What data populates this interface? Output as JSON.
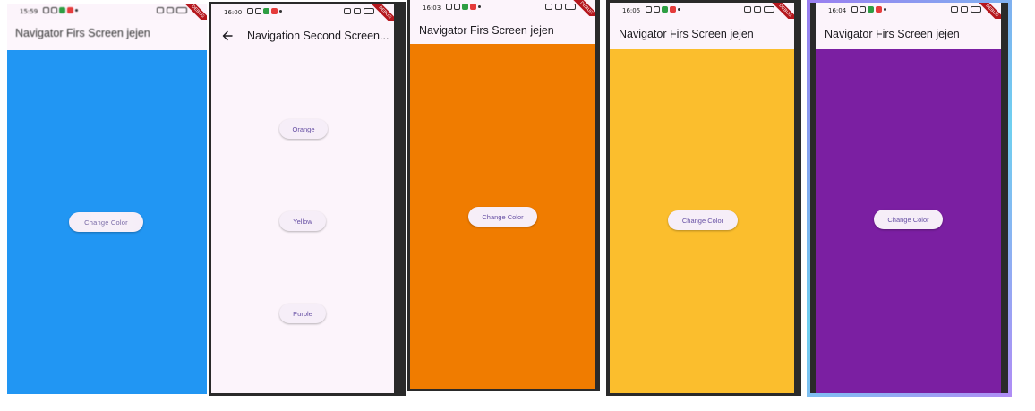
{
  "screens": [
    {
      "id": "blue",
      "status_time": "15:59",
      "title": "Navigator Firs Screen jejen",
      "bg_color": "#2196f3",
      "button_label": "Change Color"
    },
    {
      "id": "second",
      "status_time": "16:00",
      "title": "Navigation Second Screen...",
      "bg_color": "#fcf4fb",
      "buttons": [
        "Orange",
        "Yellow",
        "Purple"
      ]
    },
    {
      "id": "orange",
      "status_time": "16:03",
      "title": "Navigator Firs Screen jejen",
      "bg_color": "#f07c00",
      "button_label": "Change Color"
    },
    {
      "id": "yellow",
      "status_time": "16:05",
      "title": "Navigator Firs Screen jejen",
      "bg_color": "#fbbe2d",
      "button_label": "Change Color"
    },
    {
      "id": "purple",
      "status_time": "16:04",
      "title": "Navigator Firs Screen jejen",
      "bg_color": "#7b1fa2",
      "button_label": "Change Color"
    }
  ],
  "debug_banner": "DEBUG",
  "colors": {
    "appbar_bg": "#fcf4fb",
    "button_text": "#6750a4",
    "button_bg": "#f6eef8"
  },
  "icons": {
    "back": "arrow-left-icon"
  }
}
